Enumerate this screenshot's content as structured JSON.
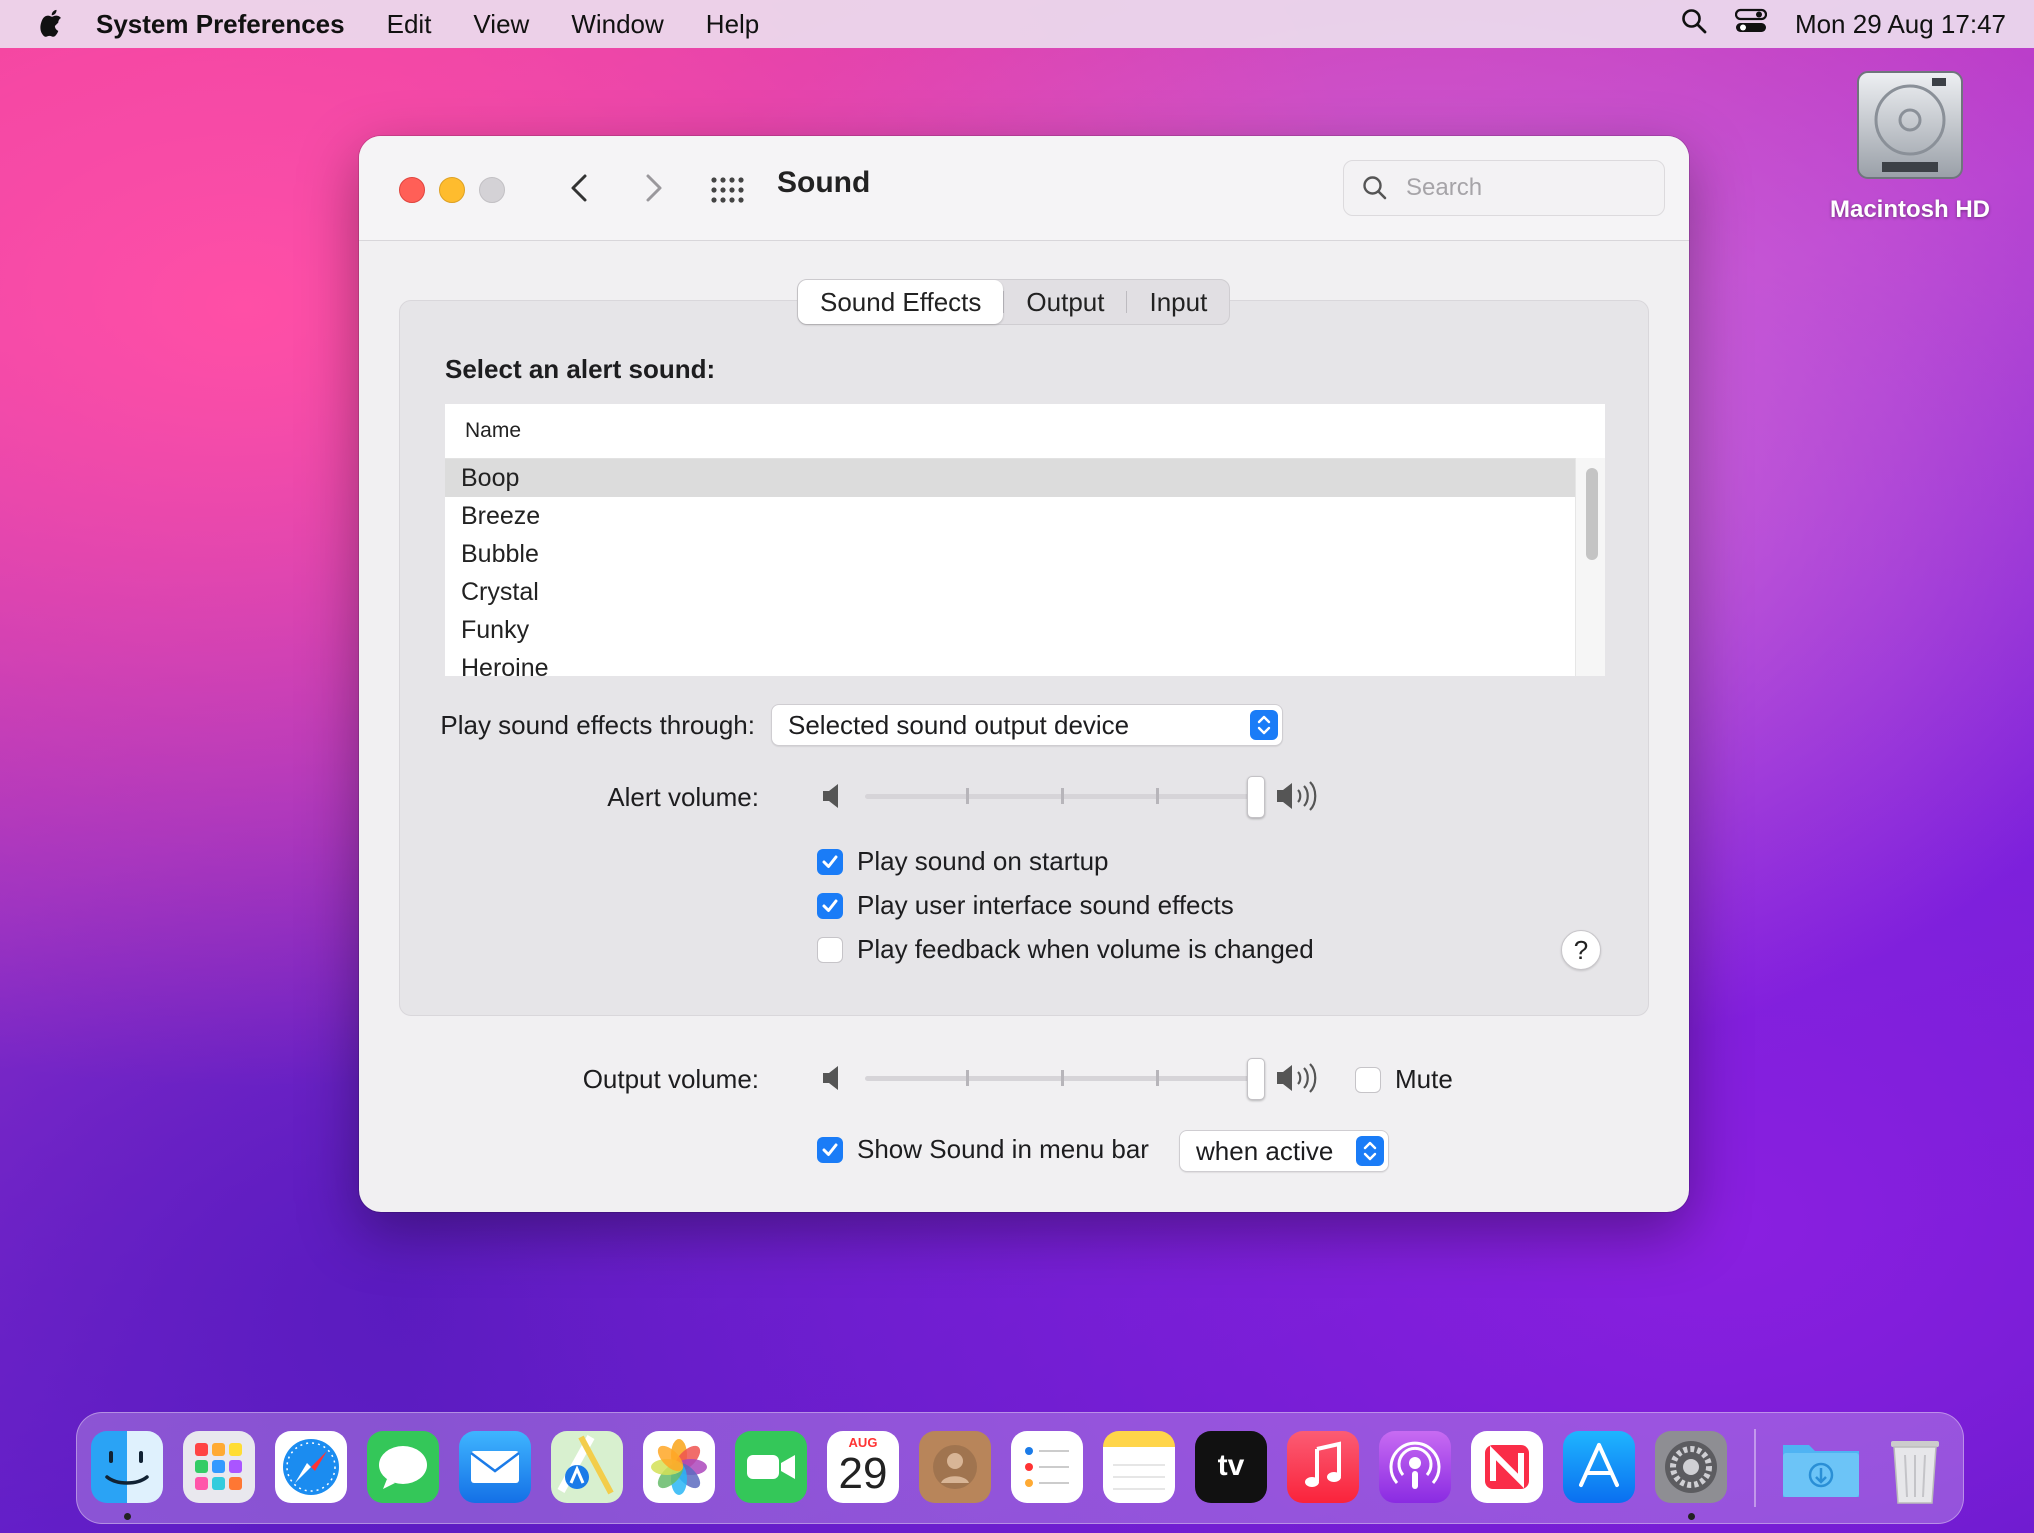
{
  "menubar": {
    "app_name": "System Preferences",
    "menus": [
      "Edit",
      "View",
      "Window",
      "Help"
    ],
    "date_time": "Mon 29 Aug  17:47"
  },
  "desktop": {
    "disk_label": "Macintosh HD"
  },
  "window": {
    "title": "Sound",
    "search_placeholder": "Search",
    "tabs": [
      "Sound Effects",
      "Output",
      "Input"
    ],
    "active_tab": "Sound Effects",
    "select_alert_label": "Select an alert sound:",
    "list_header": "Name",
    "alert_sounds": [
      "Boop",
      "Breeze",
      "Bubble",
      "Crystal",
      "Funky",
      "Heroine"
    ],
    "selected_alert": "Boop",
    "play_through_label": "Play sound effects through:",
    "play_through_value": "Selected sound output device",
    "alert_volume_label": "Alert volume:",
    "alert_volume": 1.0,
    "checkboxes": [
      {
        "label": "Play sound on startup",
        "checked": true
      },
      {
        "label": "Play user interface sound effects",
        "checked": true
      },
      {
        "label": "Play feedback when volume is changed",
        "checked": false
      }
    ],
    "help_label": "?",
    "output_volume_label": "Output volume:",
    "output_volume": 1.0,
    "mute_label": "Mute",
    "mute_checked": false,
    "show_in_menubar_label": "Show Sound in menu bar",
    "show_in_menubar_checked": true,
    "show_in_menubar_value": "when active"
  },
  "dock": {
    "calendar_month": "AUG",
    "calendar_day": "29",
    "tv_label": "tv",
    "apps": [
      "finder-icon",
      "launchpad-icon",
      "safari-icon",
      "messages-icon",
      "mail-icon",
      "maps-icon",
      "photos-icon",
      "facetime-icon",
      "calendar-icon",
      "contacts-icon",
      "reminders-icon",
      "notes-icon",
      "apple-tv-icon",
      "music-icon",
      "podcasts-icon",
      "news-icon",
      "app-store-icon",
      "system-preferences-icon",
      "downloads-folder-icon",
      "trash-icon"
    ]
  }
}
